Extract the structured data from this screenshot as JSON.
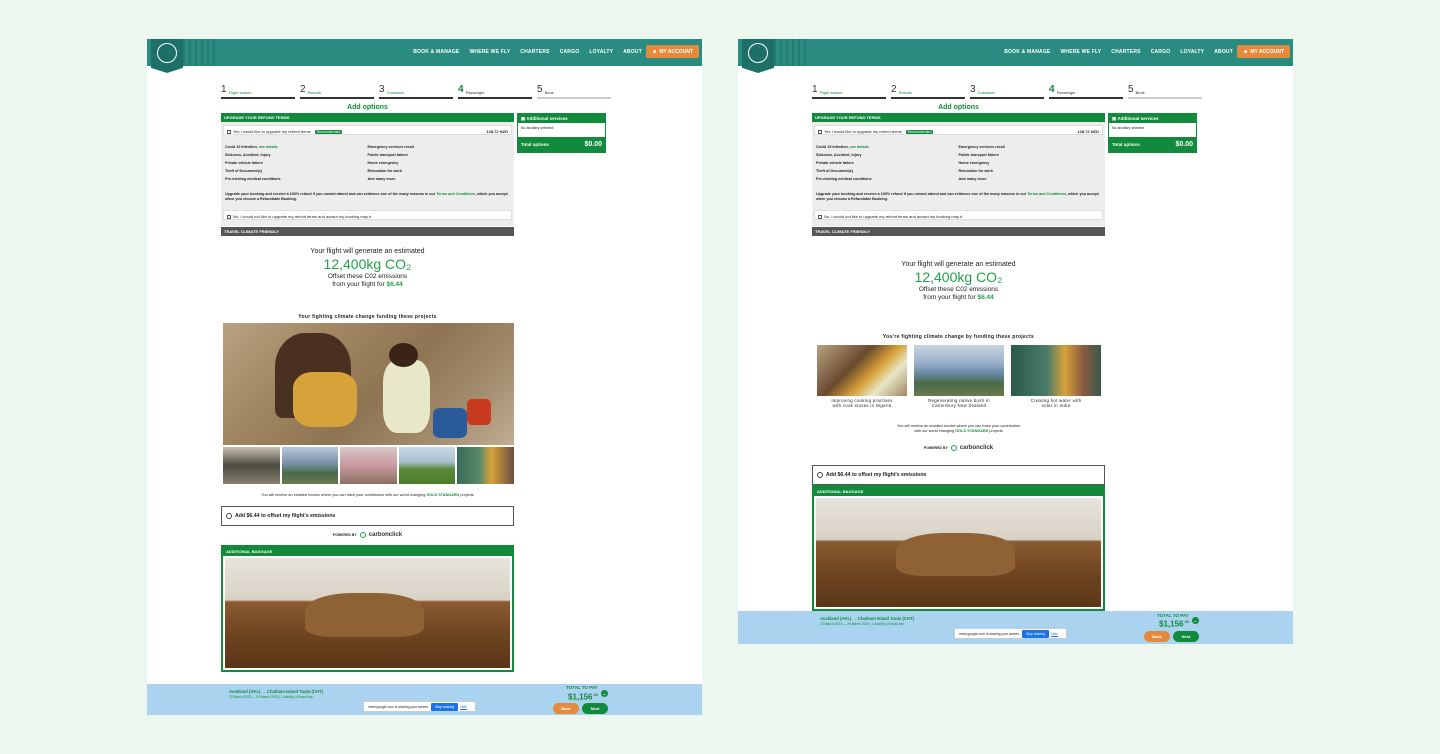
{
  "header": {
    "nav": [
      "BOOK & MANAGE",
      "WHERE WE FLY",
      "CHARTERS",
      "CARGO",
      "LOYALTY",
      "ABOUT"
    ],
    "account": "MY ACCOUNT"
  },
  "steps": [
    {
      "n": "1",
      "label": "Flight search"
    },
    {
      "n": "2",
      "label": "Results"
    },
    {
      "n": "3",
      "label": "Customer"
    },
    {
      "n": "4",
      "label": "Passenger"
    },
    {
      "n": "5",
      "label": "Book"
    }
  ],
  "add_options": "Add options",
  "refund": {
    "header": "UPGRADE YOUR REFUND TERMS",
    "yes": "Yes I would like to upgrade my refund terms",
    "recommended": "Recommended",
    "price": "128.72 NZD",
    "reasons_left": [
      "Covid 19 infection",
      "Sickness, Accident, Injury",
      "Private vehicle failure",
      "Theft of Document(s)",
      "Pre-existing medical conditions"
    ],
    "see_details": "see details",
    "reasons_right": [
      "Emergency services recall",
      "Public transport failure",
      "Home emergency",
      "Relocation for work",
      "And many more"
    ],
    "upgrade_text_a": "Upgrade your booking and receive a 100% refund if you cannot attend and can evidence one of the many reasons in our",
    "upgrade_link": "Terms and Conditions",
    "upgrade_text_b": ", which you accept when you choose a Refundable Booking.",
    "no": "No, I would not like to upgrade my refund terms and accept my booking may b"
  },
  "travel_climate": "TRAVEL CLIMATE FRIENDLY",
  "co2": {
    "line1": "Your flight will generate an estimated",
    "amount": "12,400kg CO₂",
    "line2": "Offset these C02 emissions",
    "line3": "from your flight for",
    "price": "$6.44"
  },
  "fund_title_1": "Your fighting climate change funding these  projects",
  "fund_title_2": "You're fighting climate change by funding these projects",
  "projects": [
    {
      "t1": "Improving cooking practises",
      "t2": "with cook stoves in Nigeria"
    },
    {
      "t1": "Regenerating native bush in",
      "t2": "Canterbury New Zealand"
    },
    {
      "t1": "Creating hot water with",
      "t2": "solar in India"
    }
  ],
  "invoice_1a": "You will receive an emailed invoice where you can trace your contribution with our world changing",
  "invoice_gold": "GOLD STANDARD",
  "invoice_1b": "projects",
  "invoice_2a": "You will receive an emailed invoice where you can trace your contribution",
  "invoice_2b": "with our world changing",
  "offset_label": "Add $6.44 to offset my flight's emissions",
  "powered_by": "POWERED BY",
  "carbonclick": "carbonclick",
  "baggage_header": "ADDITIONAL BAGGAGE",
  "side": {
    "header": "Additional services",
    "none": "No ancillary selected",
    "total_label": "Total options",
    "total_value": "$0.00"
  },
  "footer": {
    "route": "Auckland (AKL) → Chatham Island Tuuta (CHT)",
    "details": "23 March 2023 — 29 March 2023  |  1 Adult(s)  |  Round trip",
    "share": "meet.google.com is sharing your screen.",
    "stop": "Stop sharing",
    "hide": "Hide",
    "total_label": "TOTAL TO PAY",
    "total_value": "$1,156",
    "total_cents": ".00",
    "back": "Back",
    "next": "Next"
  },
  "colors": {
    "brand": "#2a8c80",
    "green": "#118a3c",
    "accent": "#e58a3c",
    "footer": "#a9d3ee"
  }
}
